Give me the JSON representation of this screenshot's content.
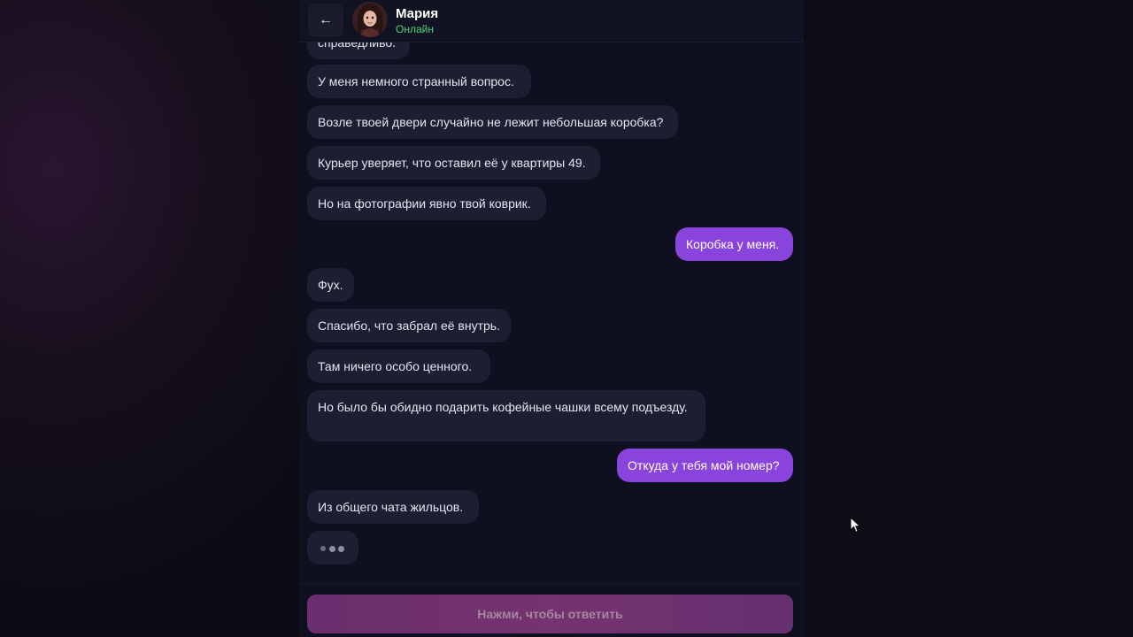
{
  "header": {
    "back_icon": "arrow-left-icon",
    "back_glyph": "←",
    "contact_name": "Мария",
    "status": "Онлайн",
    "status_color": "#4cd47f"
  },
  "messages": [
    {
      "from": "contact",
      "text": "справедливо."
    },
    {
      "from": "contact",
      "text": "У меня немного странный вопрос."
    },
    {
      "from": "contact",
      "text": "Возле твоей двери случайно не лежит небольшая коробка?"
    },
    {
      "from": "contact",
      "text": "Курьер уверяет, что оставил её у квартиры 49."
    },
    {
      "from": "contact",
      "text": "Но на фотографии явно твой коврик."
    },
    {
      "from": "me",
      "text": "Коробка у меня."
    },
    {
      "from": "contact",
      "text": "Фух."
    },
    {
      "from": "contact",
      "text": "Спасибо, что забрал её внутрь."
    },
    {
      "from": "contact",
      "text": "Там ничего особо ценного."
    },
    {
      "from": "contact",
      "text": "Но было бы обидно подарить кофейные чашки всему подъезду."
    },
    {
      "from": "me",
      "text": "Откуда у тебя мой номер?"
    },
    {
      "from": "contact",
      "text": "Из общего чата жильцов."
    }
  ],
  "typing_indicator": true,
  "footer": {
    "reply_label": "Нажми, чтобы ответить"
  },
  "colors": {
    "outgoing_bubble": "#8a44de",
    "incoming_bubble": "#1c1f32",
    "background": "#0e1020"
  }
}
